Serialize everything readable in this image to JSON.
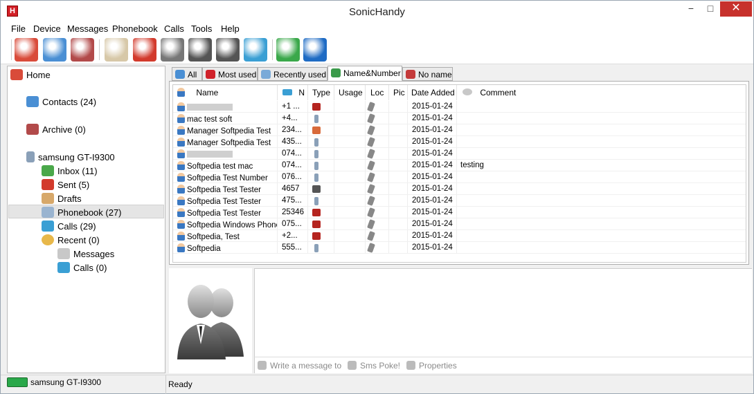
{
  "window": {
    "title": "SonicHandy",
    "minimize": "−",
    "maximize": "□",
    "close": "✕"
  },
  "menu": [
    "File",
    "Device",
    "Messages",
    "Phonebook",
    "Calls",
    "Tools",
    "Help"
  ],
  "toolbar": [
    {
      "name": "home-icon",
      "color": "#d94b3a"
    },
    {
      "name": "contacts-icon",
      "color": "#4a8fd4"
    },
    {
      "name": "archive-icon",
      "color": "#b24a4a"
    },
    {
      "name": "compose-icon",
      "color": "#d7c8a8"
    },
    {
      "name": "delete-icon",
      "color": "#d23a2c"
    },
    {
      "name": "edit-contact-icon",
      "color": "#777777"
    },
    {
      "name": "add-contact-icon",
      "color": "#555555"
    },
    {
      "name": "remove-contact-icon",
      "color": "#555555"
    },
    {
      "name": "sync-icon",
      "color": "#3a9fd4"
    },
    {
      "name": "add-device-icon",
      "color": "#3aa84a"
    },
    {
      "name": "info-icon",
      "color": "#1e6bc4"
    }
  ],
  "sidebar": {
    "home": "Home",
    "contacts": "Contacts (24)",
    "archive": "Archive (0)",
    "device": "samsung GT-I9300",
    "inbox": "Inbox (11)",
    "sent": "Sent (5)",
    "drafts": "Drafts",
    "phonebook": "Phonebook (27)",
    "calls": "Calls (29)",
    "recent": "Recent (0)",
    "recent_messages": "Messages",
    "recent_calls": "Calls (0)"
  },
  "tabs": [
    {
      "label": "All",
      "color": "#4a8fd4"
    },
    {
      "label": "Most used",
      "color": "#d0222a"
    },
    {
      "label": "Recently used",
      "color": "#7aaad8"
    },
    {
      "label": "Name&Number",
      "color": "#3a9a4a"
    },
    {
      "label": "No name",
      "color": "#c43a3a"
    }
  ],
  "grid": {
    "columns": [
      "Name",
      "N",
      "Type",
      "Usage",
      "Loc",
      "Pic",
      "Date Added",
      "Comment"
    ],
    "rows": [
      {
        "name": "",
        "blurred": true,
        "number": "+1 ...",
        "type": "work",
        "date": "2015-01-24",
        "comment": ""
      },
      {
        "name": "mac test soft",
        "blurred": false,
        "number": "+4...",
        "type": "mobile",
        "date": "2015-01-24",
        "comment": ""
      },
      {
        "name": "Manager Softpedia Test",
        "blurred": false,
        "number": "234...",
        "type": "home",
        "date": "2015-01-24",
        "comment": ""
      },
      {
        "name": "Manager Softpedia Test",
        "blurred": false,
        "number": "435...",
        "type": "mobile",
        "date": "2015-01-24",
        "comment": ""
      },
      {
        "name": "",
        "blurred": true,
        "number": "074...",
        "type": "mobile",
        "date": "2015-01-24",
        "comment": ""
      },
      {
        "name": "Softpedia test mac",
        "blurred": false,
        "number": "074...",
        "type": "mobile",
        "date": "2015-01-24",
        "comment": "testing"
      },
      {
        "name": "Softpedia Test Number",
        "blurred": false,
        "number": "076...",
        "type": "mobile",
        "date": "2015-01-24",
        "comment": ""
      },
      {
        "name": "Softpedia Test Tester",
        "blurred": false,
        "number": "4657",
        "type": "fax",
        "date": "2015-01-24",
        "comment": ""
      },
      {
        "name": "Softpedia Test Tester",
        "blurred": false,
        "number": "475...",
        "type": "mobile",
        "date": "2015-01-24",
        "comment": ""
      },
      {
        "name": "Softpedia Test Tester",
        "blurred": false,
        "number": "25346",
        "type": "work",
        "date": "2015-01-24",
        "comment": ""
      },
      {
        "name": "Softpedia Windows Phone",
        "blurred": false,
        "number": "075...",
        "type": "work",
        "date": "2015-01-24",
        "comment": ""
      },
      {
        "name": "Softpedia, Test",
        "blurred": false,
        "number": "+2...",
        "type": "work",
        "date": "2015-01-24",
        "comment": ""
      },
      {
        "name": "Softpedia",
        "blurred": false,
        "number": "555...",
        "type": "mobile",
        "date": "2015-01-24",
        "comment": ""
      }
    ]
  },
  "type_colors": {
    "work": "#b5241f",
    "mobile": "#8aa0b8",
    "home": "#d86a3a",
    "fax": "#555555"
  },
  "message_actions": [
    "Write a message to",
    "Sms Poke!",
    "Properties"
  ],
  "status": {
    "device": "samsung GT-I9300",
    "state": "Ready"
  }
}
